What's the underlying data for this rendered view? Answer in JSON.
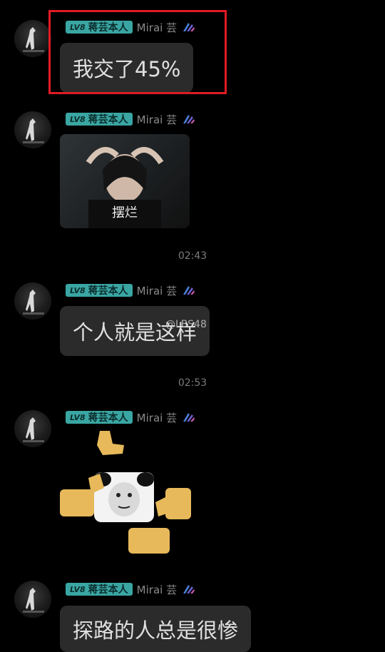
{
  "sender": {
    "level": "LV8",
    "title": "蒋芸本人",
    "name": "Mirai 芸"
  },
  "messages": [
    {
      "type": "text",
      "text": "我交了45%"
    },
    {
      "type": "image",
      "caption": "摆烂"
    },
    {
      "type": "text",
      "text": "个人就是这样"
    },
    {
      "type": "sticker"
    },
    {
      "type": "text",
      "text": "探路的人总是很惨"
    }
  ],
  "timestamps": [
    "02:43",
    "02:53"
  ],
  "watermark": "@LBS48",
  "colors": {
    "badge": "#3aa6a3",
    "bubble": "#2b2b2b",
    "highlight": "#e01b24",
    "background": "#000000"
  }
}
